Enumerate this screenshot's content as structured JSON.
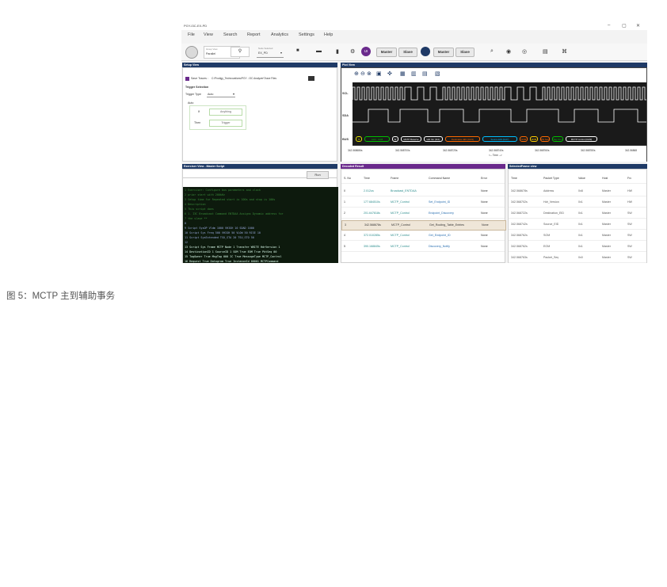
{
  "app": {
    "title": "PGY-I3C-EX-PD",
    "window_controls": [
      "–",
      "▢",
      "✕"
    ],
    "menu": [
      "File",
      "View",
      "Search",
      "Report",
      "Analytics",
      "Settings",
      "Help"
    ],
    "toolbar": {
      "group1_small_label": "Group View",
      "group1_value": "Parallel",
      "device_label": "Node Selected",
      "device_value": "EX_PD",
      "ui_badge": "UI",
      "btn_master": "Master",
      "btn_slave": "Slave",
      "btn_master2": "Master",
      "btn_slave2": "Slave"
    },
    "setup_view": {
      "header": "Setup View",
      "save_traces_label": "Save Traces :",
      "save_traces_path": "C:\\Prodigy_Technovations\\PGY - I3C Analyzer\\Trace Files",
      "trigger_selection": "Trigger Selection",
      "trigger_type_label": "Trigger Type",
      "trigger_type_value": "Auto",
      "auto_label": "Auto",
      "if_label": "If",
      "if_value": "Anything",
      "then_label": "Then",
      "then_value": "Trigger"
    },
    "plot_view": {
      "header": "Plot View",
      "lanes": [
        "SCL",
        "SDA",
        "BUS"
      ],
      "bus_segments": [
        "S",
        "Addr : 0x08",
        "W",
        "MCTP Reserve",
        "Hdr Ver (0x1)",
        "Destination EID (0x01)",
        "Source EID (0x07)",
        "SOM",
        "EOM",
        "Pkt Seq",
        "Tag Own",
        "MCTP Control (0x00)"
      ],
      "time_ticks": [
        "342.568686s",
        "342.568700s",
        "342.568725s",
        "342.568740s",
        "342.568760s",
        "342.568780s",
        "342.56868"
      ],
      "time_label": "<-- Time -->"
    },
    "exerciser": {
      "header": "Exerciser View - Master Script",
      "run_label": "Run",
      "lines": [
        "1  Exerciser: Configure bus parameters and clock",
        "2  prior start with 200kHz",
        "3  Setup time for Repeated start is 100s and stop is 100s",
        "4  Description",
        "5  This script does",
        "6  1. I3C Broadcast Command ENTDAA Assigns Dynamic address for",
        "7  the slave **",
        "8",
        "9  Script SysOP Vldm 1000 VHIGH 10 SDAD 1000",
        "10 Script Sys Freq 500 VHIGH 50 VLOW 50 RISE 10",
        "11 Script SysExtended TSU_STA 20 TSU_STO 50",
        "12",
        "13    Script Sys Frame MCTP Node 1 Transfer WRITE HdrVersion 1",
        "14    DestinationID 1 SourceID 1 SOM True EOM True PktSeq 00",
        "15    TagOwner True MsgTag 000 IC True MessageType MCTP_Control",
        "16    Request True Datagram True InstanceId 00001 MCTPCommand"
      ]
    },
    "decoded": {
      "header": "Decoded Result",
      "columns": [
        "S. No",
        "Time",
        "Frame",
        "Command Name",
        "Error"
      ],
      "rows": [
        [
          "0",
          "2.012us",
          "Broadcast_ENTDAA",
          "",
          "None"
        ],
        [
          "1",
          "177.684510s",
          "MCTP_Control",
          "Set_Endpoint_ID",
          "None"
        ],
        [
          "2",
          "201.647818s",
          "MCTP_Control",
          "Endpoint_Discovery",
          "None"
        ],
        [
          "3",
          "342.568678s",
          "MCTP_Control",
          "Get_Routing_Table_Entries",
          "None"
        ],
        [
          "4",
          "372.010285s",
          "MCTP_Control",
          "Get_Endpoint_ID",
          "None"
        ],
        [
          "5",
          "390.168845s",
          "MCTP_Control",
          "Discovery_Notify",
          "None"
        ]
      ]
    },
    "selected_frame": {
      "header": "SelectedFrame view",
      "columns": [
        "Time",
        "Packet Type",
        "Value",
        "Host",
        "Fro"
      ],
      "rows": [
        [
          "342.568678s",
          "Address",
          "0x8",
          "Master",
          "HW"
        ],
        [
          "342.568702s",
          "Hdr_Version",
          "0x1",
          "Master",
          "HW"
        ],
        [
          "342.568722s",
          "Destination_EID",
          "0x1",
          "Master",
          "SW"
        ],
        [
          "342.568742s",
          "Source_EID",
          "0x1",
          "Master",
          "SW"
        ],
        [
          "342.568762s",
          "SOM",
          "0x1",
          "Master",
          "SW"
        ],
        [
          "342.568762s",
          "EOM",
          "0x1",
          "Master",
          "SW"
        ],
        [
          "342.568763s",
          "Packet_Seq",
          "0x0",
          "Master",
          "SW"
        ]
      ]
    }
  },
  "caption": "图 5：MCTP 主到辅助事务",
  "colors": {
    "panel_header": "#1f3a66",
    "accent_purple": "#6a2a8c",
    "wave": "#ffffff",
    "script_bg": "#0d1a0d"
  }
}
